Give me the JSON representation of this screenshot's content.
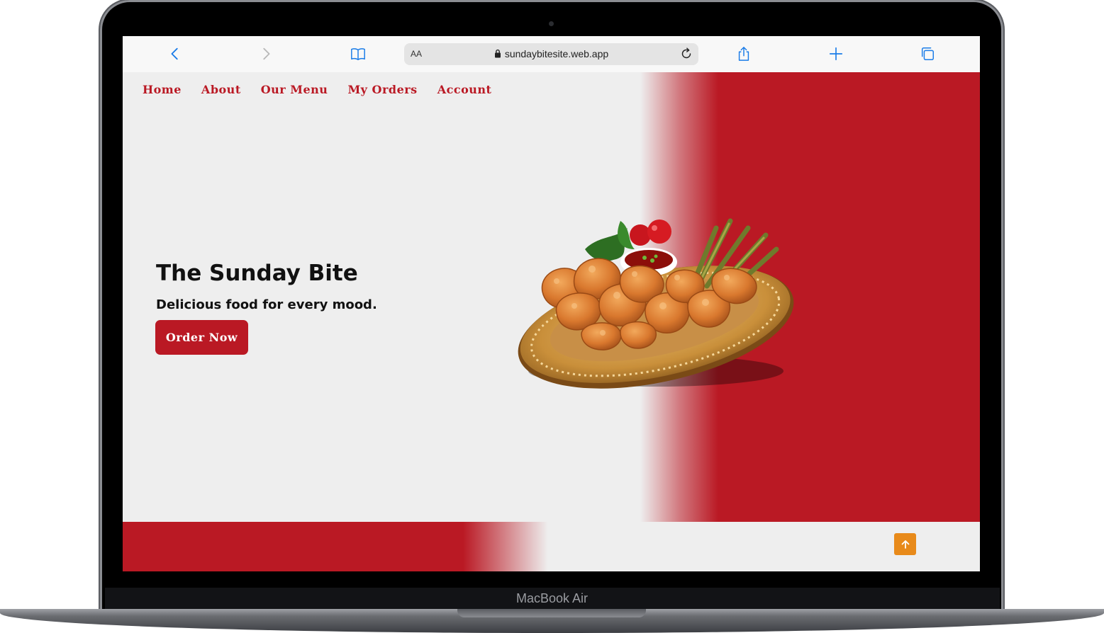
{
  "device": {
    "model_label": "MacBook Air"
  },
  "browser": {
    "text_size_label": "AA",
    "url": "sundaybitesite.web.app",
    "icons": {
      "back": "chevron-left-icon",
      "forward": "chevron-right-icon",
      "bookmarks": "book-icon",
      "lock": "lock-icon",
      "reload": "reload-icon",
      "share": "share-icon",
      "new_tab": "plus-icon",
      "tabs": "tabs-icon"
    },
    "accent_color": "#1a7ce8"
  },
  "nav": {
    "items": [
      {
        "label": "Home"
      },
      {
        "label": "About"
      },
      {
        "label": "Our Menu"
      },
      {
        "label": "My Orders"
      },
      {
        "label": "Account"
      }
    ]
  },
  "hero": {
    "title": "The Sunday Bite",
    "subtitle": "Delicious food for every mood.",
    "cta_label": "Order Now",
    "image": "fried-chicken-platter"
  },
  "scroll_top": {
    "icon": "arrow-up-icon"
  },
  "colors": {
    "brand_red": "#ba1924",
    "page_bg": "#eeeeee",
    "scroll_button": "#e88a1a"
  }
}
